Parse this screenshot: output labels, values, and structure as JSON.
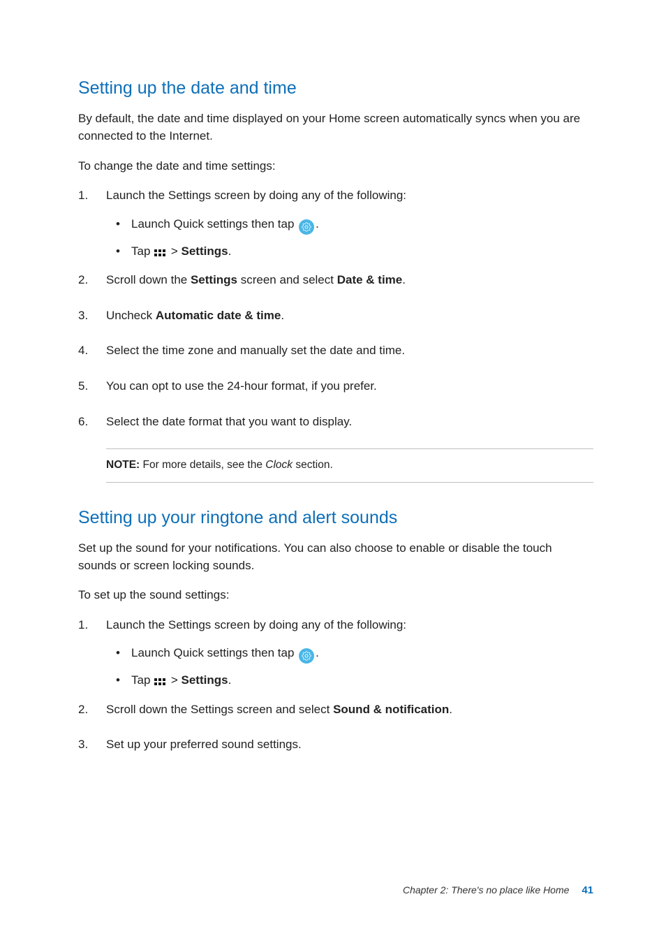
{
  "section1": {
    "heading": "Setting up the date and time",
    "intro": "By default, the date and time displayed on your Home screen automatically syncs when you are connected to the Internet.",
    "lead": "To change the date and time settings:",
    "step1_text": "Launch the Settings screen by doing any of the following:",
    "sub_a_prefix": "Launch Quick settings then tap ",
    "sub_a_suffix": ".",
    "sub_b_prefix": "Tap ",
    "sub_b_gt": " > ",
    "sub_b_settings": "Settings",
    "sub_b_suffix": ".",
    "step2_a": "Scroll down the ",
    "step2_b": "Settings",
    "step2_c": " screen and select ",
    "step2_d": "Date & time",
    "step2_e": ".",
    "step3_a": "Uncheck ",
    "step3_b": "Automatic date & time",
    "step3_c": ".",
    "step4": "Select the time zone and manually set the date and time.",
    "step5": "You can opt to use the 24-hour format, if you prefer.",
    "step6": "Select the date format that you want to display.",
    "note_label": "NOTE:",
    "note_a": " For more details, see the ",
    "note_clock": "Clock",
    "note_b": " section."
  },
  "section2": {
    "heading": "Setting up your ringtone and alert sounds",
    "intro": "Set up the sound for your notifications. You can also choose to enable or disable the touch sounds or screen locking sounds.",
    "lead": "To set up the sound settings:",
    "step1_text": "Launch the Settings screen by doing any of the following:",
    "sub_a_prefix": "Launch Quick settings then tap ",
    "sub_a_suffix": ".",
    "sub_b_prefix": "Tap ",
    "sub_b_gt": " > ",
    "sub_b_settings": "Settings",
    "sub_b_suffix": ".",
    "step2_a": "Scroll down the Settings screen and select ",
    "step2_b": "Sound & notification",
    "step2_c": ".",
    "step3": "Set up your preferred sound settings."
  },
  "footer": {
    "chapter": "Chapter 2: There's no place like Home",
    "page": "41"
  }
}
